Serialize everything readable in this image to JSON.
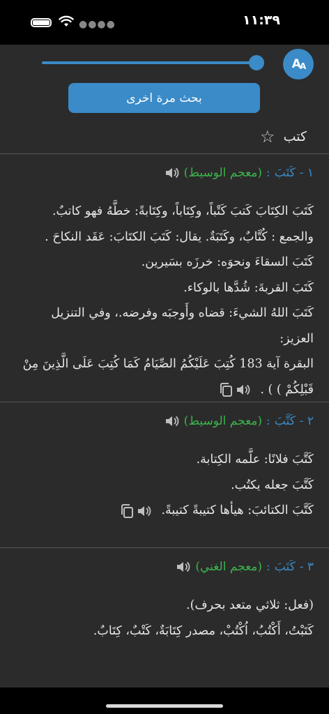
{
  "status": {
    "time": "١١:٣٩"
  },
  "toolbar": {
    "aa_label_big": "A",
    "aa_label_small": "A",
    "search_again_label": "بحث مرة اخرى",
    "query": "كتب",
    "font_size_fraction": 0.97
  },
  "colors": {
    "accent": "#3a8bc8",
    "dict_green": "#39b54a",
    "background": "#2b2b2b"
  },
  "entries": [
    {
      "num": "١ -",
      "word": "كَتَبَ",
      "sep": ":",
      "dict": "(معجم الوسيط)",
      "lines": [
        "كَتَبَ الكِتَابَ كَتبَ كَتْباً، وكِتَاباً، وكِتَابةً: خطَّهُ فهو كاتبٌ.",
        "والجمع : كُتَّابٌ، وكَتَبَةٌ. يقال: كَتَبَ الكتَابَ: عَقَد النكاحَ .",
        "كَتَبَ السقاءَ ونحوَه: خرزَه بسَيرين.",
        "كَتَبَ القربةَ: شُدَّها بالوكاء.",
        "كَتَبَ اللهُ الشيءَ: قضاه وأَوجبَه وفرضه.، وفي التنزيل العزيز:",
        "البقرة آية 183 كُتِبَ عَلَيْكُمُ الصِّيَامُ كَمَا كُتِبَ عَلَى الَّذِينَ مِنْ",
        "قَبْلِكُمْ ) ) ."
      ]
    },
    {
      "num": "٢ -",
      "word": "كَتَّبَ",
      "sep": ":",
      "dict": "(معجم الوسيط)",
      "lines": [
        "كَتَّبَ فلانًا: علَّمه الكِتابة.",
        "كَتَّبَ جعله يكتُب.",
        "كَتَّبَ الكتائبَ: هيأها كتيبةً كتيبةً."
      ]
    },
    {
      "num": "٣ -",
      "word": "كَتَبَ",
      "sep": ":",
      "dict": "(معجم الغني)",
      "lines": [
        "(فعل: ثلاثي متعد بحرف).",
        "كَتَبْتُ، أَكْتُبُ، اُكْتُبْ، مصدر كِتَابَةٌ، كَتْبٌ، كِتَابٌ."
      ]
    }
  ]
}
